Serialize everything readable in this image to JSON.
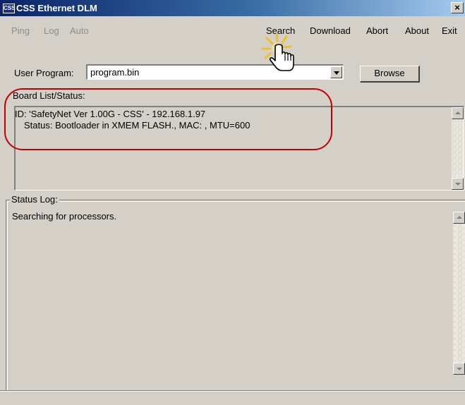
{
  "window": {
    "title": "CSS Ethernet DLM",
    "icon_label": "CSS",
    "close_glyph": "×"
  },
  "menu": {
    "left": [
      {
        "label": "Ping",
        "enabled": false
      },
      {
        "label": "Log",
        "enabled": false
      },
      {
        "label": "Auto",
        "enabled": false
      }
    ],
    "right": [
      {
        "label": "Search",
        "enabled": true
      },
      {
        "label": "Download",
        "enabled": true
      },
      {
        "label": "Abort",
        "enabled": true
      },
      {
        "label": "About",
        "enabled": true
      },
      {
        "label": "Exit",
        "enabled": true
      }
    ]
  },
  "user_program": {
    "label": "User Program:",
    "value": "program.bin",
    "browse_label": "Browse"
  },
  "board_list": {
    "label": "Board List/Status:",
    "lines": [
      "ID: 'SafetyNet Ver 1.00G - CSS' - 192.168.1.97",
      "Status: Bootloader in XMEM FLASH., MAC: , MTU=600"
    ]
  },
  "status_log": {
    "label": "Status Log:",
    "lines": [
      "Searching for processors."
    ]
  },
  "annotations": {
    "highlight_color": "#c00000",
    "cursor": "hand-pointer-icon",
    "click_burst_color": "#f0c020"
  }
}
